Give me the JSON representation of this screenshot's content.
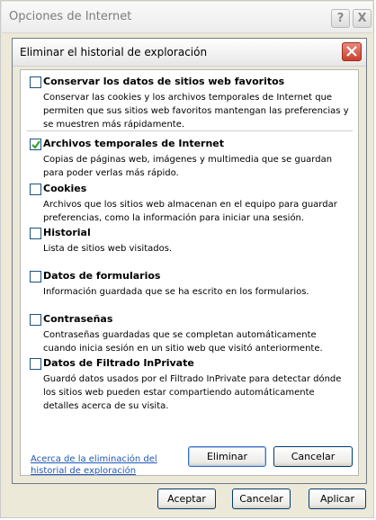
{
  "outer_window": {
    "title": "Opciones de Internet",
    "help_glyph": "?",
    "close_glyph": "X"
  },
  "dialog": {
    "title": "Eliminar el historial de exploración",
    "close_icon": "close-icon",
    "accent_close": "#c8412c"
  },
  "options": [
    {
      "label": "Conservar los datos de sitios web favoritos",
      "checked": false,
      "description": "Conservar las cookies y los archivos temporales de Internet que permiten que sus sitios web favoritos mantengan las preferencias y se muestren más rápidamente."
    },
    {
      "label": "Archivos temporales de Internet",
      "checked": true,
      "description": "Copias de páginas web, imágenes y multimedia que se guardan para poder verlas más rápido."
    },
    {
      "label": "Cookies",
      "checked": false,
      "description": "Archivos que los sitios web almacenan en el equipo para guardar preferencias, como la información para iniciar una sesión."
    },
    {
      "label": "Historial",
      "checked": false,
      "description": "Lista de sitios web visitados."
    },
    {
      "label": "Datos de formularios",
      "checked": false,
      "description": "Información guardada que se ha escrito en los formularios."
    },
    {
      "label": "Contraseñas",
      "checked": false,
      "description": "Contraseñas guardadas que se completan automáticamente cuando inicia sesión en un sitio web que visitó anteriormente."
    },
    {
      "label": "Datos de Filtrado InPrivate",
      "checked": false,
      "description": "Guardó datos usados por el Filtrado InPrivate para detectar dónde los sitios web pueden estar compartiendo automáticamente detalles acerca de su visita."
    }
  ],
  "link_text": "Acerca de la eliminación del historial de exploración",
  "buttons": {
    "delete": "Eliminar",
    "cancel": "Cancelar"
  },
  "outer_buttons": {
    "accept": "Aceptar",
    "cancel": "Cancelar",
    "apply": "Aplicar"
  }
}
